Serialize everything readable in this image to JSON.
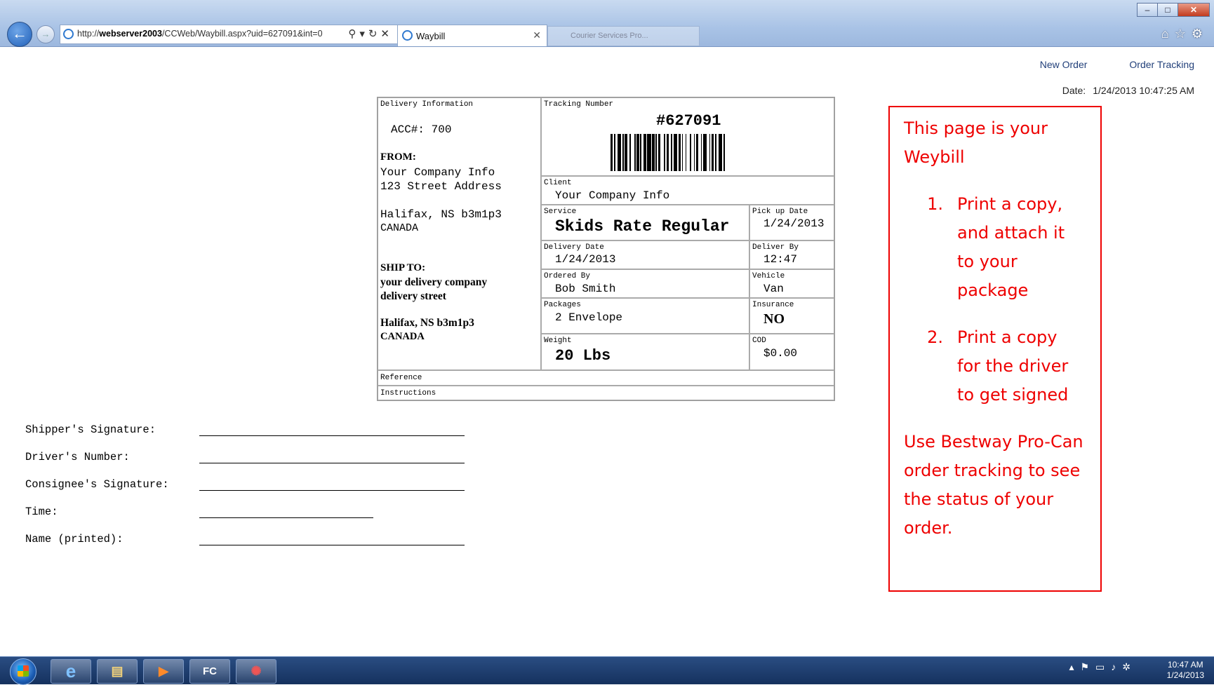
{
  "browser": {
    "url_prefix": "http://",
    "url_host": "webserver2003",
    "url_path": "/CCWeb/Waybill.aspx?uid=627091&int=0",
    "tab_title": "Waybill",
    "tab2_title": "Courier Services Pro..."
  },
  "page": {
    "links": [
      "New Order",
      "Order Tracking"
    ],
    "date_label": "Date:",
    "date_value": "1/24/2013 10:47:25 AM"
  },
  "waybill": {
    "delivery_info_label": "Delivery Information",
    "acc": "ACC#: 700",
    "from_label": "FROM:",
    "from_lines": [
      "Your Company Info",
      "123 Street Address",
      "",
      "Halifax, NS   b3m1p3",
      "CANADA"
    ],
    "ship_to_label": "SHIP TO:",
    "ship_to_lines": [
      "your delivery company",
      "delivery street",
      "",
      "Halifax, NS   b3m1p3",
      "CANADA"
    ],
    "tracking_label": "Tracking Number",
    "tracking_number": "#627091",
    "client_label": "Client",
    "client": "Your Company Info",
    "service_label": "Service",
    "service": "Skids Rate Regular",
    "pickup_label": "Pick up Date",
    "pickup": "1/24/2013",
    "delivery_date_label": "Delivery Date",
    "delivery_date": "1/24/2013",
    "deliver_by_label": "Deliver By",
    "deliver_by": "12:47",
    "ordered_by_label": "Ordered By",
    "ordered_by": "Bob Smith",
    "vehicle_label": "Vehicle",
    "vehicle": "Van",
    "packages_label": "Packages",
    "packages": "2 Envelope",
    "insurance_label": "Insurance",
    "insurance": "NO",
    "weight_label": "Weight",
    "weight": "20 Lbs",
    "cod_label": "COD",
    "cod": "$0.00",
    "reference_label": "Reference",
    "instructions_label": "Instructions"
  },
  "note": {
    "intro": "This page is your Weybill",
    "steps": [
      {
        "num": "1.",
        "text": "Print a copy, and attach it to your package"
      },
      {
        "num": "2.",
        "text": "Print a copy for the driver to get signed"
      }
    ],
    "outro": "Use Bestway Pro-Can order tracking to see the status of your order."
  },
  "signatures": [
    {
      "label": "Shipper's Signature:"
    },
    {
      "label": "Driver's Number:"
    },
    {
      "label": "Consignee's Signature:"
    },
    {
      "label": "Time:"
    },
    {
      "label": "Name (printed):"
    }
  ],
  "taskbar": {
    "apps": [
      "internet-explorer",
      "file-explorer",
      "media-player",
      "fc-app",
      "network-app"
    ],
    "fc_label": "FC",
    "time": "10:47 AM",
    "date": "1/24/2013"
  },
  "colors": {
    "accent_red": "#e00000",
    "link": "#22407a"
  }
}
